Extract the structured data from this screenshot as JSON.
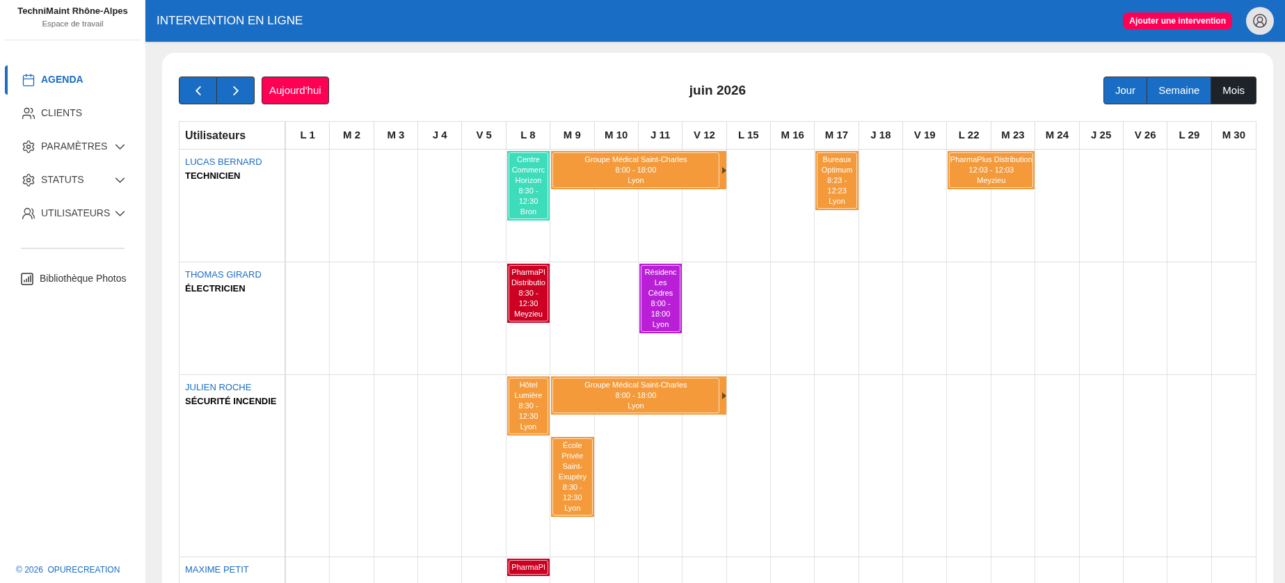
{
  "sidebar": {
    "company": "TechniMaint Rhône-Alpes",
    "subtitle": "Espace de travail",
    "items": [
      {
        "label": "AGENDA",
        "selected": true,
        "has_submenu": false
      },
      {
        "label": "CLIENTS",
        "selected": false,
        "has_submenu": false
      },
      {
        "label": "PARAMÈTRES",
        "selected": false,
        "has_submenu": true
      },
      {
        "label": "STATUTS",
        "selected": false,
        "has_submenu": true
      },
      {
        "label": "UTILISATEURS",
        "selected": false,
        "has_submenu": true
      }
    ],
    "secondary_items": [
      {
        "label": "Bibliothèque Photos",
        "selected": false
      }
    ],
    "footer": "© 2026  OPURECREATION"
  },
  "header": {
    "title": "INTERVENTION EN LIGNE",
    "add_button": "Ajouter une intervention"
  },
  "toolbar": {
    "today_button": "Aujourd'hui",
    "period_title": "juin 2026",
    "views": [
      {
        "label": "Jour",
        "selected": false
      },
      {
        "label": "Semaine",
        "selected": false
      },
      {
        "label": "Mois",
        "selected": true
      }
    ]
  },
  "table": {
    "first_column": "Utilisateurs",
    "days": [
      "L 1",
      "M 2",
      "M 3",
      "J 4",
      "V 5",
      "L 8",
      "M 9",
      "M 10",
      "J 11",
      "V 12",
      "L 15",
      "M 16",
      "M 17",
      "J 18",
      "V 19",
      "L 22",
      "M 23",
      "M 24",
      "J 25",
      "V 26",
      "L 29",
      "M 30"
    ],
    "rows": [
      {
        "name": "LUCAS BERNARD",
        "role": "TECHNICIEN",
        "cells": [
          null,
          null,
          null,
          null,
          null,
          {
            "events": [
              {
                "kind": "single",
                "title": "Centre Commerc Horizon",
                "time": "8:30 - 12:30",
                "place": "Bron",
                "color": "#3ddcbb",
                "continues": false
              }
            ]
          },
          {
            "events": [
              {
                "kind": "quad",
                "title": "Groupe Médical Saint-Charles",
                "time": "8:00 - 18:00",
                "place": "Lyon",
                "color": "#f49a3a",
                "continues": true
              }
            ]
          },
          null,
          null,
          null,
          null,
          null,
          {
            "events": [
              {
                "kind": "single",
                "title": "Bureaux Optimum",
                "time": "8:23 - 12:23",
                "place": "Lyon",
                "color": "#f49a3a",
                "continues": false
              }
            ]
          },
          null,
          null,
          {
            "events": [
              {
                "kind": "double",
                "title": "PharmaPlus Distribution",
                "time": "12:03 - 12:03",
                "place": "Meyzieu",
                "color": "#f49a3a",
                "continues": false
              }
            ]
          }
        ]
      },
      {
        "name": "THOMAS GIRARD",
        "role": "ÉLECTRICIEN",
        "cells": [
          null,
          null,
          null,
          null,
          null,
          {
            "events": [
              {
                "kind": "single",
                "title": "PharmaPl Distributio",
                "time": "8:30 - 12:30",
                "place": "Meyzieu",
                "color": "#cc0022",
                "continues": false
              }
            ]
          },
          null,
          null,
          {
            "events": [
              {
                "kind": "single",
                "title": "Résidenc Les Cèdres",
                "time": "8:00 - 18:00",
                "place": "Lyon",
                "color": "#b81fd6",
                "continues": false
              }
            ]
          }
        ]
      },
      {
        "name": "JULIEN ROCHE",
        "role": "SÉCURITÉ INCENDIE",
        "cells": [
          null,
          null,
          null,
          null,
          null,
          {
            "events": [
              {
                "kind": "single",
                "title": "Hôtel Lumière",
                "time": "8:30 - 12:30",
                "place": "Lyon",
                "color": "#f49a3a",
                "continues": false
              }
            ]
          },
          {
            "events": [
              {
                "kind": "quad",
                "title": "Groupe Médical Saint-Charles",
                "time": "8:00 - 18:00",
                "place": "Lyon",
                "color": "#f49a3a",
                "continues": true
              },
              {
                "kind": "single",
                "title": "École Privée Saint-Exupéry",
                "time": "8:30 - 12:30",
                "place": "Lyon",
                "color": "#f49a3a",
                "continues": false
              }
            ]
          }
        ]
      },
      {
        "name": "MAXIME PETIT",
        "cells": [
          null,
          null,
          null,
          null,
          null,
          {
            "events": [
              {
                "kind": "single",
                "title": "PharmaPl",
                "color": "#cc0022",
                "continues": false
              }
            ]
          }
        ]
      }
    ]
  }
}
